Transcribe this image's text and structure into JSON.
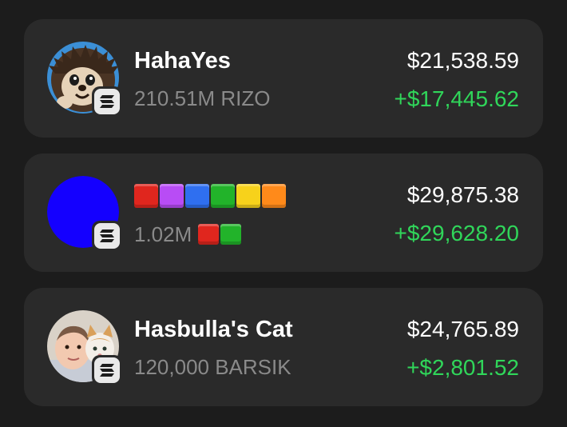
{
  "tokens": [
    {
      "name": "HahaYes",
      "amount": "210.51M RIZO",
      "value": "$21,538.59",
      "pnl": "+$17,445.62",
      "avatar_icon": "hedgehog-avatar-icon",
      "chain_icon": "solana-icon"
    },
    {
      "name": "",
      "name_blocks": [
        "#e0261e",
        "#b84cf5",
        "#2f6ff0",
        "#22b32a",
        "#f7d21b",
        "#ff8a1a"
      ],
      "amount": "1.02M",
      "amount_blocks": [
        "#e0261e",
        "#22b32a"
      ],
      "value": "$29,875.38",
      "pnl": "+$29,628.20",
      "avatar_color": "#1400ff",
      "chain_icon": "solana-icon"
    },
    {
      "name": "Hasbulla's Cat",
      "amount": "120,000 BARSIK",
      "value": "$24,765.89",
      "pnl": "+$2,801.52",
      "avatar_icon": "hasbulla-cat-avatar-icon",
      "chain_icon": "solana-icon"
    }
  ],
  "colors": {
    "background": "#1c1c1c",
    "card": "#2a2a2a",
    "positive": "#30d65a",
    "muted_text": "#8a8a8a"
  }
}
